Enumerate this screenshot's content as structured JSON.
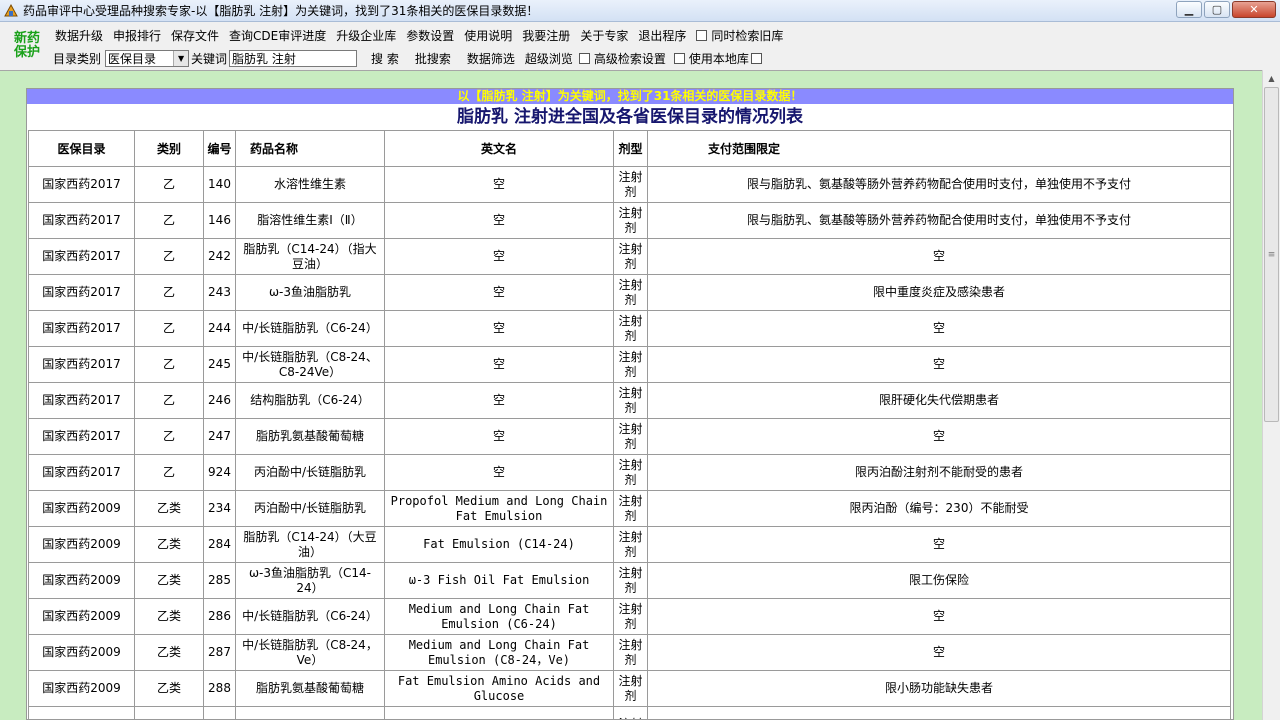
{
  "window": {
    "title": "药品审评中心受理品种搜索专家-以【脂肪乳 注射】为关键词，找到了31条相关的医保目录数据！",
    "minimize": "▁",
    "maximize": "▢",
    "close": "✕"
  },
  "logo": {
    "line1": "新药",
    "line2": "保护"
  },
  "menu": {
    "items": [
      "数据升级",
      "申报排行",
      "保存文件",
      "查询CDE审评进度",
      "升级企业库",
      "参数设置",
      "使用说明",
      "我要注册",
      "关于专家",
      "退出程序"
    ],
    "check_old": "同时检索旧库"
  },
  "search": {
    "category_label": "目录类别",
    "category_value": "医保目录",
    "keyword_label": "关键词",
    "keyword_value": "脂肪乳 注射",
    "search_button": "搜  索",
    "batch_button": "批搜索",
    "filter_button": "数据筛选",
    "browse_button": "超级浏览",
    "advanced_label": "高级检索设置",
    "local_label": "使用本地库"
  },
  "report": {
    "banner": "以【脂肪乳 注射】为关键词，找到了31条相关的医保目录数据！",
    "title": "脂肪乳 注射进全国及各省医保目录的情况列表",
    "columns": [
      "医保目录",
      "类别",
      "编号",
      "药品名称",
      "英文名",
      "剂型",
      "支付范围限定"
    ],
    "rows": [
      [
        "国家西药2017",
        "乙",
        "140",
        "水溶性维生素",
        "空",
        "注射剂",
        "限与脂肪乳、氨基酸等肠外营养药物配合使用时支付，单独使用不予支付"
      ],
      [
        "国家西药2017",
        "乙",
        "146",
        "脂溶性维生素Ⅰ（Ⅱ）",
        "空",
        "注射剂",
        "限与脂肪乳、氨基酸等肠外营养药物配合使用时支付，单独使用不予支付"
      ],
      [
        "国家西药2017",
        "乙",
        "242",
        "脂肪乳（C14-24）（指大豆油）",
        "空",
        "注射剂",
        "空"
      ],
      [
        "国家西药2017",
        "乙",
        "243",
        "ω-3鱼油脂肪乳",
        "空",
        "注射剂",
        "限中重度炎症及感染患者"
      ],
      [
        "国家西药2017",
        "乙",
        "244",
        "中/长链脂肪乳（C6-24）",
        "空",
        "注射剂",
        "空"
      ],
      [
        "国家西药2017",
        "乙",
        "245",
        "中/长链脂肪乳（C8-24、C8-24Ve）",
        "空",
        "注射剂",
        "空"
      ],
      [
        "国家西药2017",
        "乙",
        "246",
        "结构脂肪乳（C6-24）",
        "空",
        "注射剂",
        "限肝硬化失代偿期患者"
      ],
      [
        "国家西药2017",
        "乙",
        "247",
        "脂肪乳氨基酸葡萄糖",
        "空",
        "注射剂",
        "空"
      ],
      [
        "国家西药2017",
        "乙",
        "924",
        "丙泊酚中/长链脂肪乳",
        "空",
        "注射剂",
        "限丙泊酚注射剂不能耐受的患者"
      ],
      [
        "国家西药2009",
        "乙类",
        "234",
        "丙泊酚中/长链脂肪乳",
        "Propofol Medium and Long Chain Fat Emulsion",
        "注射剂",
        "限丙泊酚（编号：230）不能耐受"
      ],
      [
        "国家西药2009",
        "乙类",
        "284",
        "脂肪乳（C14-24）（大豆油）",
        "Fat Emulsion (C14-24)",
        "注射剂",
        "空"
      ],
      [
        "国家西药2009",
        "乙类",
        "285",
        "ω-3鱼油脂肪乳（C14-24）",
        "ω-3 Fish Oil Fat Emulsion",
        "注射剂",
        "限工伤保险"
      ],
      [
        "国家西药2009",
        "乙类",
        "286",
        "中/长链脂肪乳（C6-24）",
        "Medium and Long Chain Fat Emulsion (C6-24)",
        "注射剂",
        "空"
      ],
      [
        "国家西药2009",
        "乙类",
        "287",
        "中/长链脂肪乳（C8-24，Ve）",
        "Medium and Long Chain Fat Emulsion (C8-24，Ve)",
        "注射剂",
        "空"
      ],
      [
        "国家西药2009",
        "乙类",
        "288",
        "脂肪乳氨基酸葡萄糖",
        "Fat Emulsion Amino Acids and Glucose",
        "注射剂",
        "限小肠功能缺失患者"
      ],
      [
        "",
        "",
        "",
        "",
        "",
        "注射",
        ""
      ]
    ]
  },
  "colors": {
    "banner_bg": "#8a8aff",
    "banner_text": "#ffff00",
    "frame_bg": "#c8ecc0",
    "title_text": "#16166e",
    "logo": "#1aa11a"
  }
}
